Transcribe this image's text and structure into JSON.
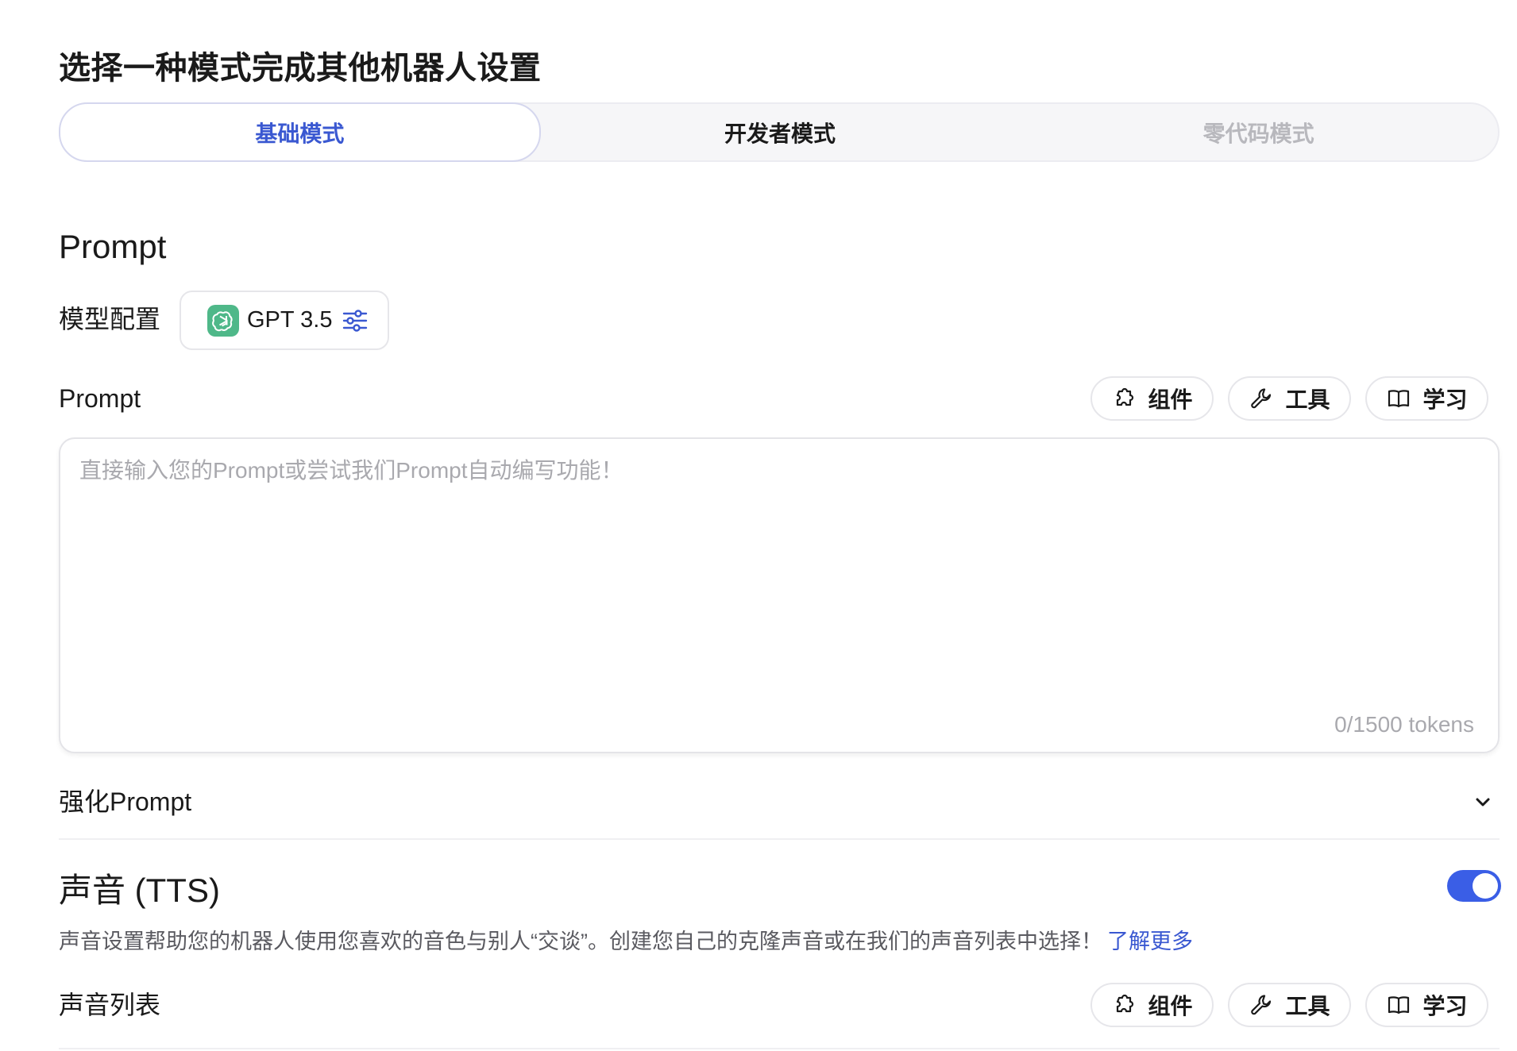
{
  "page": {
    "title": "选择一种模式完成其他机器人设置"
  },
  "mode_tabs": [
    {
      "label": "基础模式",
      "state": "active"
    },
    {
      "label": "开发者模式",
      "state": "normal"
    },
    {
      "label": "零代码模式",
      "state": "disabled"
    }
  ],
  "prompt_section": {
    "title": "Prompt",
    "model_label": "模型配置",
    "model_name": "GPT 3.5",
    "model_icon": "openai-logo-icon",
    "settings_icon": "sliders-icon",
    "prompt_label": "Prompt",
    "actions": {
      "components": "组件",
      "tools": "工具",
      "learn": "学习"
    },
    "placeholder": "直接输入您的Prompt或尝试我们Prompt自动编写功能！",
    "value": "",
    "token_count": "0/1500 tokens"
  },
  "enhance": {
    "label": "强化Prompt",
    "expanded": false
  },
  "tts": {
    "title": "声音 (TTS)",
    "enabled": true,
    "description": "声音设置帮助您的机器人使用您喜欢的音色与别人“交谈”。创建您自己的克隆声音或在我们的声音列表中选择！",
    "learn_more": "了解更多",
    "voice_list_label": "声音列表",
    "actions": {
      "components": "组件",
      "tools": "工具",
      "learn": "学习"
    }
  },
  "colors": {
    "accent": "#3a58d1",
    "toggle_on": "#3a5ee6",
    "logo_green": "#4fb889"
  }
}
